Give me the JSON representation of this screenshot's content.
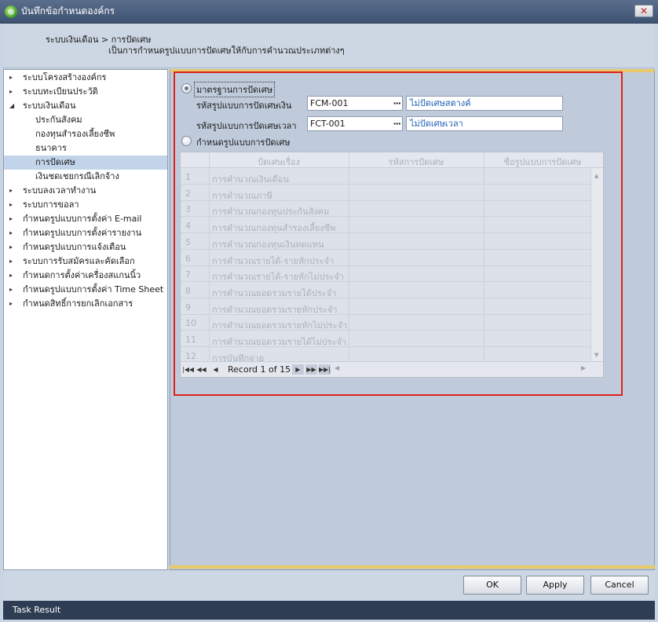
{
  "window": {
    "title": "บันทึกข้อกำหนดองค์กร",
    "close_label": "✕"
  },
  "header": {
    "breadcrumb": "ระบบเงินเดือน > การปัดเศษ",
    "subtitle": "เป็นการกำหนดรูปแบบการปัดเศษให้กับการคำนวณประเภทต่างๆ"
  },
  "tree": {
    "items": [
      {
        "label": "ระบบโครงสร้างองค์กร",
        "arrow": "▸"
      },
      {
        "label": "ระบบทะเบียนประวัติ",
        "arrow": "▸"
      },
      {
        "label": "ระบบเงินเดือน",
        "arrow": "◢"
      },
      {
        "label": "ประกันสังคม"
      },
      {
        "label": "กองทุนสำรองเลี้ยงชีพ"
      },
      {
        "label": "ธนาคาร"
      },
      {
        "label": "การปัดเศษ"
      },
      {
        "label": "เงินชดเชยกรณีเลิกจ้าง"
      },
      {
        "label": "ระบบลงเวลาทำงาน",
        "arrow": "▸"
      },
      {
        "label": "ระบบการขอลา",
        "arrow": "▸"
      },
      {
        "label": "กำหนดรูปแบบการตั้งค่า E-mail",
        "arrow": "▸"
      },
      {
        "label": "กำหนดรูปแบบการตั้งค่ารายงาน",
        "arrow": "▸"
      },
      {
        "label": "กำหนดรูปแบบการแจ้งเตือน",
        "arrow": "▸"
      },
      {
        "label": "ระบบการรับสมัครและคัดเลือก",
        "arrow": "▸"
      },
      {
        "label": "กำหนดการตั้งค่าเครื่องสแกนนิ้ว",
        "arrow": "▸"
      },
      {
        "label": "กำหนดรูปแบบการตั้งค่า Time Sheet",
        "arrow": "▸"
      },
      {
        "label": "กำหนดสิทธิ์การยกเลิกเอกสาร",
        "arrow": "▸"
      }
    ]
  },
  "form": {
    "radio_standard": "มาตรฐานการปัดเศษ",
    "money_label": "รหัสรูปแบบการปัดเศษเงิน",
    "money_code": "FCM-001",
    "money_desc": "ไม่ปัดเศษสตางค์",
    "time_label": "รหัสรูปแบบการปัดเศษเวลา",
    "time_code": "FCT-001",
    "time_desc": "ไม่ปัดเศษเวลา",
    "radio_custom": "กำหนดรูปแบบการปัดเศษ",
    "dots": "···"
  },
  "grid": {
    "headers": [
      "ปัดเศษเรื่อง",
      "รหัสการปัดเศษ",
      "ชื่อรูปแบบการปัดเศษ"
    ],
    "rows": [
      {
        "num": "1",
        "name": "การคำนวณเงินเดือน"
      },
      {
        "num": "2",
        "name": "การคำนวณภาษี"
      },
      {
        "num": "3",
        "name": "การคำนวณกองทุนประกันสังคม"
      },
      {
        "num": "4",
        "name": "การคำนวณกองทุนสำรองเลี้ยงชีพ"
      },
      {
        "num": "5",
        "name": "การคำนวณกองทุนเงินทดแทน"
      },
      {
        "num": "6",
        "name": "การคำนวณรายได้-รายหักประจำ"
      },
      {
        "num": "7",
        "name": "การคำนวณรายได้-รายหักไม่ประจำ"
      },
      {
        "num": "8",
        "name": "การคำนวณยอดรวมรายได้ประจำ"
      },
      {
        "num": "9",
        "name": "การคำนวณยอดรวมรายหักประจำ"
      },
      {
        "num": "10",
        "name": "การคำนวณยอดรวมรายหักไม่ประจำ"
      },
      {
        "num": "11",
        "name": "การคำนวณยอดรวมรายได้ไม่ประจำ"
      },
      {
        "num": "12",
        "name": "การบันทึกจ่าย"
      }
    ],
    "record_text": "Record 1 of 15"
  },
  "footer": {
    "ok": "OK",
    "apply": "Apply",
    "cancel": "Cancel"
  },
  "status": {
    "text": "Task Result"
  },
  "colors": {
    "highlight_box": "#e0201a",
    "accent": "#e8c96a",
    "link_text": "#1e5fb4"
  }
}
